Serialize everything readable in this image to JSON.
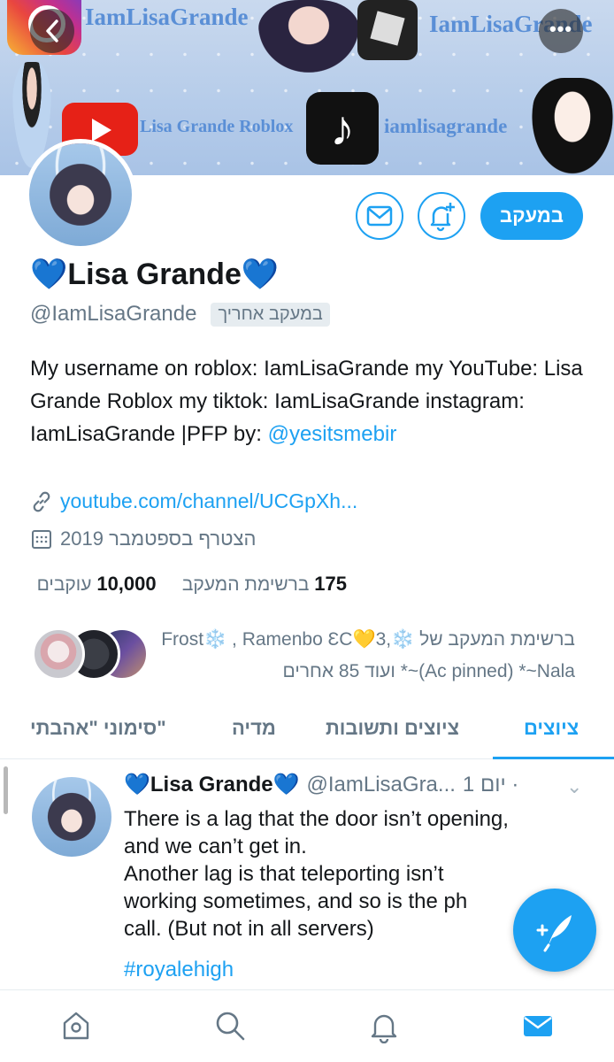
{
  "banner": {
    "text_1": "IamLisaGrande",
    "text_2": "IamLisaGrande",
    "text_3": "Lisa Grande Roblox",
    "text_4": "iamlisagrande"
  },
  "profile": {
    "name_heart_left": "💙",
    "name": "Lisa Grande",
    "name_heart_right": "💙",
    "handle": "@IamLisaGrande",
    "follows_you": "במעקב אחריך",
    "bio_text": "My username on roblox: IamLisaGrande my YouTube: Lisa Grande Roblox my tiktok: IamLisaGrande instagram: IamLisaGrande |PFP by: ",
    "bio_mention": "@yesitsmebir",
    "url": "youtube.com/channel/UCGpXh...",
    "joined": "הצטרף בספטמבר 2019",
    "following_count": "175",
    "following_label": "ברשימת המעקב",
    "followers_count": "10,000",
    "followers_label": "עוקבים",
    "followed_by": "ברשימת המעקב של ❄️Frost❄️ , Ramenbo ƐC💛3, (Ac pinned) *~Nala~* ועוד 85 אחרים"
  },
  "actions": {
    "following_button": "במעקב"
  },
  "tabs": {
    "tweets": "ציוצים",
    "tweets_replies": "ציוצים ותשובות",
    "media": "מדיה",
    "likes": "סימוני \"אהבתי\""
  },
  "tweet": {
    "name_heart_left": "💙",
    "name": "Lisa Grande",
    "name_heart_right": "💙",
    "handle": "@IamLisaGra...",
    "time": "יום 1 ·",
    "body": "There is a lag that the door isn’t opening,\nand we can’t get in.\nAnother lag is that teleporting isn’t\nworking sometimes, and so is the ph\ncall. (But not in all servers)",
    "hashtag": "#royalehigh"
  },
  "colors": {
    "accent": "#1da1f2",
    "secondary_text": "#657786",
    "heart": "#2f7de8"
  },
  "icons": {
    "back": "chevron-left-icon",
    "more": "more-icon",
    "dm": "envelope-icon",
    "notify": "bell-plus-icon",
    "link": "link-icon",
    "calendar": "calendar-icon",
    "compose": "feather-plus-icon",
    "nav": [
      "home-icon",
      "search-icon",
      "bell-icon",
      "envelope-icon"
    ]
  }
}
